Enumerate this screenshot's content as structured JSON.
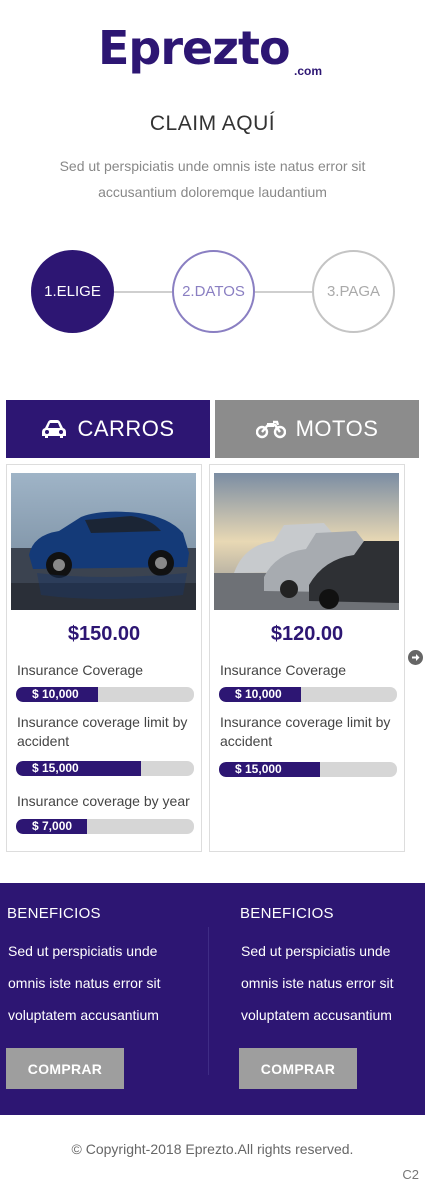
{
  "brand": {
    "name": "Eprezto",
    "suffix": ".com",
    "color": "#2d1673"
  },
  "claim": {
    "title": "CLAIM AQUÍ",
    "description": "Sed ut perspiciatis unde omnis iste natus error sit accusantium doloremque laudantium"
  },
  "steps": [
    {
      "label": "1.ELIGE",
      "state": "active"
    },
    {
      "label": "2.DATOS",
      "state": "next"
    },
    {
      "label": "3.PAGA",
      "state": "pending"
    }
  ],
  "tabs": [
    {
      "label": "CARROS",
      "icon": "car-icon",
      "active": true
    },
    {
      "label": "MOTOS",
      "icon": "motorcycle-icon",
      "active": false
    }
  ],
  "cards": [
    {
      "price": "$150.00",
      "image": "blue-suv-photo",
      "features": [
        {
          "label": "Insurance Coverage",
          "value": "$ 10,000",
          "fill_fraction": 0.46
        },
        {
          "label": "Insurance coverage limit by accident",
          "value": "$ 15,000",
          "fill_fraction": 0.7
        },
        {
          "label": "Insurance coverage by year",
          "value": "$ 7,000",
          "fill_fraction": 0.4
        }
      ]
    },
    {
      "price": "$120.00",
      "image": "parked-cars-photo",
      "features": [
        {
          "label": "Insurance Coverage",
          "value": "$ 10,000",
          "fill_fraction": 0.46
        },
        {
          "label": "Insurance coverage limit by accident",
          "value": "$ 15,000",
          "fill_fraction": 0.57
        }
      ]
    }
  ],
  "benefits": [
    {
      "title": "BENEFICIOS",
      "text": "Sed ut perspiciatis unde omnis iste natus error sit voluptatem accusantium",
      "button": "COMPRAR"
    },
    {
      "title": "BENEFICIOS",
      "text": "Sed ut perspiciatis unde omnis iste natus error sit voluptatem accusantium",
      "button": "COMPRAR"
    }
  ],
  "footer": {
    "copyright": "© Copyright-2018 Eprezto.All rights reserved.",
    "tag": "C2"
  }
}
